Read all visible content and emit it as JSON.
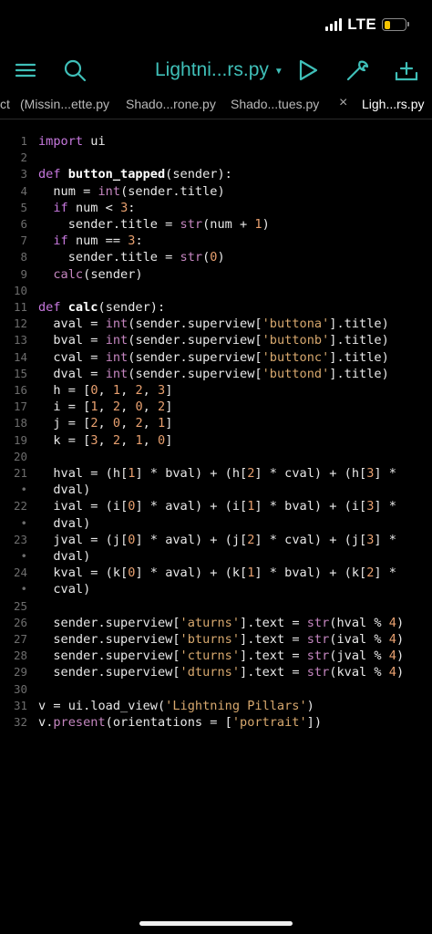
{
  "status": {
    "network": "LTE"
  },
  "toolbar": {
    "title": "Lightni...rs.py"
  },
  "tabs": [
    {
      "label": "ct"
    },
    {
      "label": "(Missin...ette.py"
    },
    {
      "label": "Shado...rone.py"
    },
    {
      "label": "Shado...tues.py"
    },
    {
      "label": "Ligh...rs.py"
    }
  ],
  "tab_close_glyph": "×",
  "lines": [
    {
      "n": "1",
      "t": "import ui"
    },
    {
      "n": "2",
      "t": ""
    },
    {
      "n": "3",
      "t": "def button_tapped(sender):"
    },
    {
      "n": "4",
      "t": "  num = int(sender.title)"
    },
    {
      "n": "5",
      "t": "  if num < 3:"
    },
    {
      "n": "6",
      "t": "    sender.title = str(num + 1)"
    },
    {
      "n": "7",
      "t": "  if num == 3:"
    },
    {
      "n": "8",
      "t": "    sender.title = str(0)"
    },
    {
      "n": "9",
      "t": "  calc(sender)"
    },
    {
      "n": "10",
      "t": ""
    },
    {
      "n": "11",
      "t": "def calc(sender):"
    },
    {
      "n": "12",
      "t": "  aval = int(sender.superview['buttona'].title)"
    },
    {
      "n": "13",
      "t": "  bval = int(sender.superview['buttonb'].title)"
    },
    {
      "n": "14",
      "t": "  cval = int(sender.superview['buttonc'].title)"
    },
    {
      "n": "15",
      "t": "  dval = int(sender.superview['buttond'].title)"
    },
    {
      "n": "16",
      "t": "  h = [0, 1, 2, 3]"
    },
    {
      "n": "17",
      "t": "  i = [1, 2, 0, 2]"
    },
    {
      "n": "18",
      "t": "  j = [2, 0, 2, 1]"
    },
    {
      "n": "19",
      "t": "  k = [3, 2, 1, 0]"
    },
    {
      "n": "20",
      "t": ""
    },
    {
      "n": "21",
      "t": "  hval = (h[1] * bval) + (h[2] * cval) + (h[3] *"
    },
    {
      "n": "•",
      "t": "  dval)"
    },
    {
      "n": "22",
      "t": "  ival = (i[0] * aval) + (i[1] * bval) + (i[3] *"
    },
    {
      "n": "•",
      "t": "  dval)"
    },
    {
      "n": "23",
      "t": "  jval = (j[0] * aval) + (j[2] * cval) + (j[3] *"
    },
    {
      "n": "•",
      "t": "  dval)"
    },
    {
      "n": "24",
      "t": "  kval = (k[0] * aval) + (k[1] * bval) + (k[2] *"
    },
    {
      "n": "•",
      "t": "  cval)"
    },
    {
      "n": "25",
      "t": ""
    },
    {
      "n": "26",
      "t": "  sender.superview['aturns'].text = str(hval % 4)"
    },
    {
      "n": "27",
      "t": "  sender.superview['bturns'].text = str(ival % 4)"
    },
    {
      "n": "28",
      "t": "  sender.superview['cturns'].text = str(jval % 4)"
    },
    {
      "n": "29",
      "t": "  sender.superview['dturns'].text = str(kval % 4)"
    },
    {
      "n": "30",
      "t": ""
    },
    {
      "n": "31",
      "t": "v = ui.load_view('Lightning Pillars')"
    },
    {
      "n": "32",
      "t": "v.present(orientations = ['portrait'])"
    }
  ],
  "icons": {
    "menu": "hamburger-menu-icon",
    "search": "search-icon",
    "run": "play-icon",
    "settings": "wrench-icon",
    "add": "add-file-icon"
  },
  "colors": {
    "accent": "#3fbfb8",
    "keyword": "#c678dd",
    "number": "#e8a06f",
    "string": "#d7a86e",
    "battery": "#f5c400"
  }
}
